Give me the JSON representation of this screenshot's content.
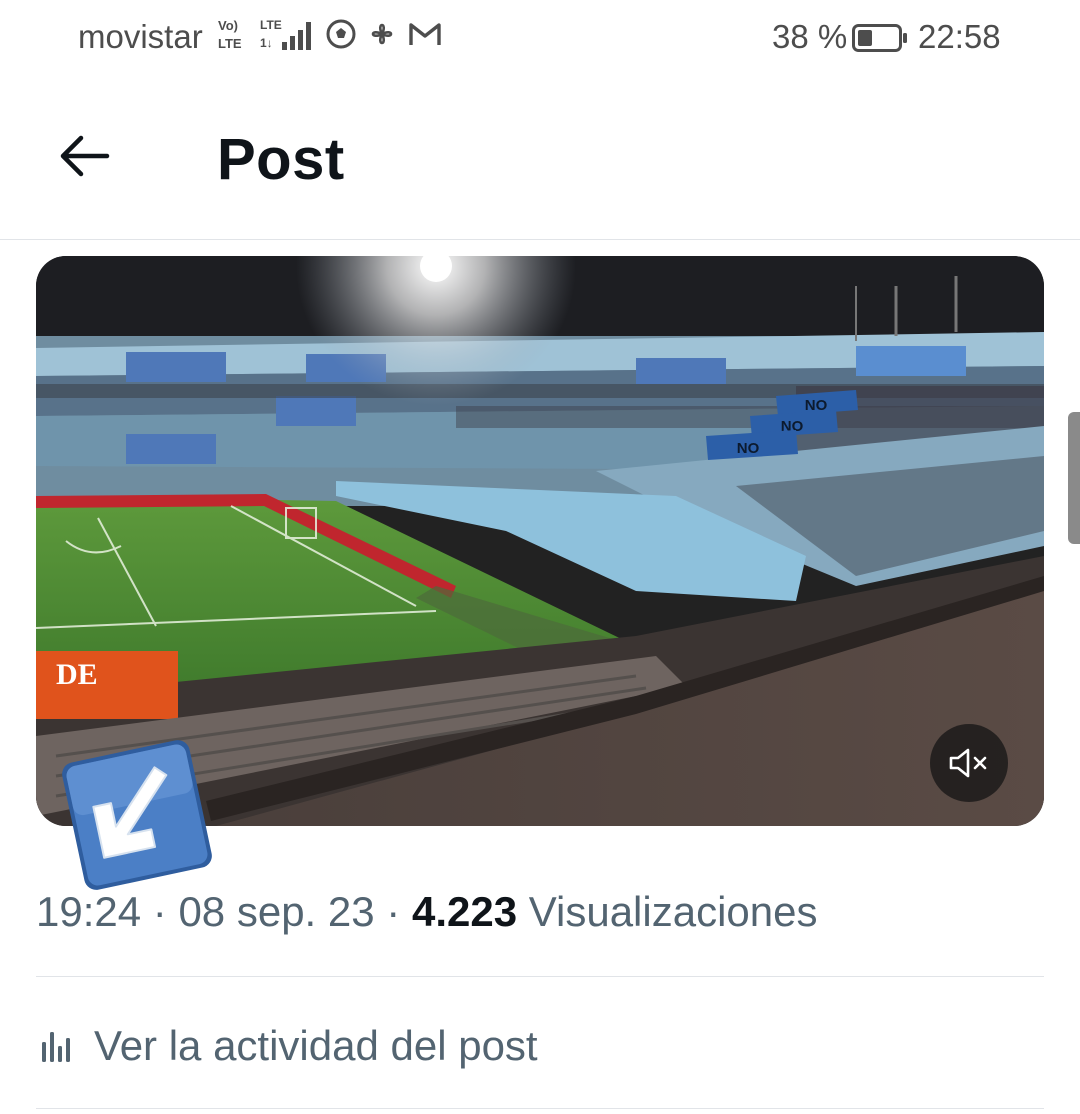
{
  "status_bar": {
    "carrier": "movistar",
    "network_badge_top": "Vo) LTE",
    "network_badge_bottom": "LTE 1↓",
    "battery_percent": "38 %",
    "battery_level": 0.38,
    "time": "22:58"
  },
  "header": {
    "back_icon": "arrow-left-icon",
    "title": "Post"
  },
  "media": {
    "type": "video",
    "sign_text": "NO",
    "ad_board_text": "DE",
    "muted": true,
    "mute_icon": "speaker-muted-icon"
  },
  "sticker": {
    "icon": "arrow-down-left-icon",
    "color": "#3d6fb5"
  },
  "post_meta": {
    "time": "19:24",
    "date": "08 sep. 23",
    "views_count": "4.223",
    "views_label": "Visualizaciones",
    "separator": "·"
  },
  "activity": {
    "icon": "bar-chart-icon",
    "label": "Ver la actividad del post"
  },
  "colors": {
    "text_primary": "#0f1419",
    "text_secondary": "#536471",
    "divider": "#e1e4e8"
  }
}
